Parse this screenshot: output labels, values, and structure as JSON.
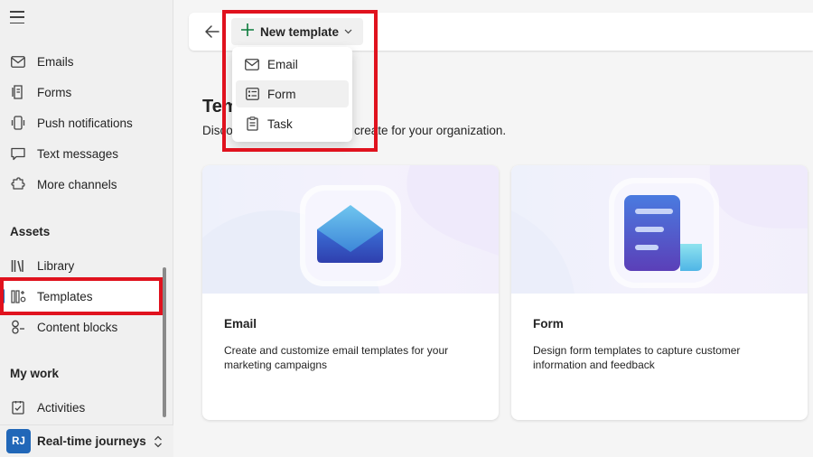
{
  "sidebar": {
    "items": [
      {
        "label": "Emails",
        "icon": "mail-icon"
      },
      {
        "label": "Forms",
        "icon": "form-icon"
      },
      {
        "label": "Push notifications",
        "icon": "push-notification-icon"
      },
      {
        "label": "Text messages",
        "icon": "text-message-icon"
      },
      {
        "label": "More channels",
        "icon": "more-channels-icon"
      }
    ],
    "assets_heading": "Assets",
    "assets_items": [
      {
        "label": "Library",
        "icon": "library-icon"
      },
      {
        "label": "Templates",
        "icon": "templates-icon",
        "active": true
      },
      {
        "label": "Content blocks",
        "icon": "content-blocks-icon"
      }
    ],
    "mywork_heading": "My work",
    "mywork_items": [
      {
        "label": "Activities",
        "icon": "activities-icon"
      }
    ],
    "area": {
      "badge": "RJ",
      "label": "Real-time journeys"
    }
  },
  "toolbar": {
    "new_template_label": "New template"
  },
  "dropdown": {
    "items": [
      {
        "label": "Email",
        "icon": "mail-icon"
      },
      {
        "label": "Form",
        "icon": "form-icon"
      },
      {
        "label": "Task",
        "icon": "task-icon"
      }
    ]
  },
  "main": {
    "title": "Tem",
    "description_start": "Disco",
    "description_end": "create for your organization."
  },
  "cards": [
    {
      "title": "Email",
      "description": "Create and customize email templates for your marketing campaigns"
    },
    {
      "title": "Form",
      "description": "Design form templates to capture customer information and feedback"
    }
  ],
  "colors": {
    "accent": "#0f6cbd",
    "highlight": "#e0121e",
    "plus": "#0b7a3b"
  }
}
